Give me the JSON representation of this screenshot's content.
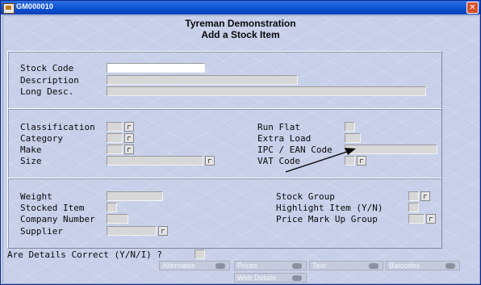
{
  "window": {
    "title": "GM000010"
  },
  "header": {
    "line1": "Tyreman Demonstration",
    "line2": "Add a Stock Item"
  },
  "stock": {
    "code_label": "Stock Code",
    "description_label": "Description",
    "long_desc_label": "Long Desc."
  },
  "details": {
    "classification_label": "Classification",
    "category_label": "Category",
    "make_label": "Make",
    "size_label": "Size",
    "run_flat_label": "Run Flat",
    "extra_load_label": "Extra Load",
    "ipc_ean_label": "IPC / EAN Code",
    "vat_code_label": "VAT Code"
  },
  "extra": {
    "weight_label": "Weight",
    "stocked_item_label": "Stocked Item",
    "company_number_label": "Company Number",
    "supplier_label": "Supplier",
    "stock_group_label": "Stock Group",
    "highlight_item_label": "Highlight Item (Y/N)",
    "price_mark_up_label": "Price Mark Up Group"
  },
  "confirm": {
    "label": "Are Details Correct (Y/N/I) ?"
  },
  "buttons": {
    "alternates": "Alternates",
    "prices": "Prices",
    "text": "Text",
    "barcodes": "Barcodes",
    "web_details": "Web Details"
  },
  "colors": {
    "titlebar": "#0a4fd0",
    "client_bg": "#c7cfe9",
    "field_bg": "#d7d7d7",
    "arrow": "#0a0a0a"
  }
}
